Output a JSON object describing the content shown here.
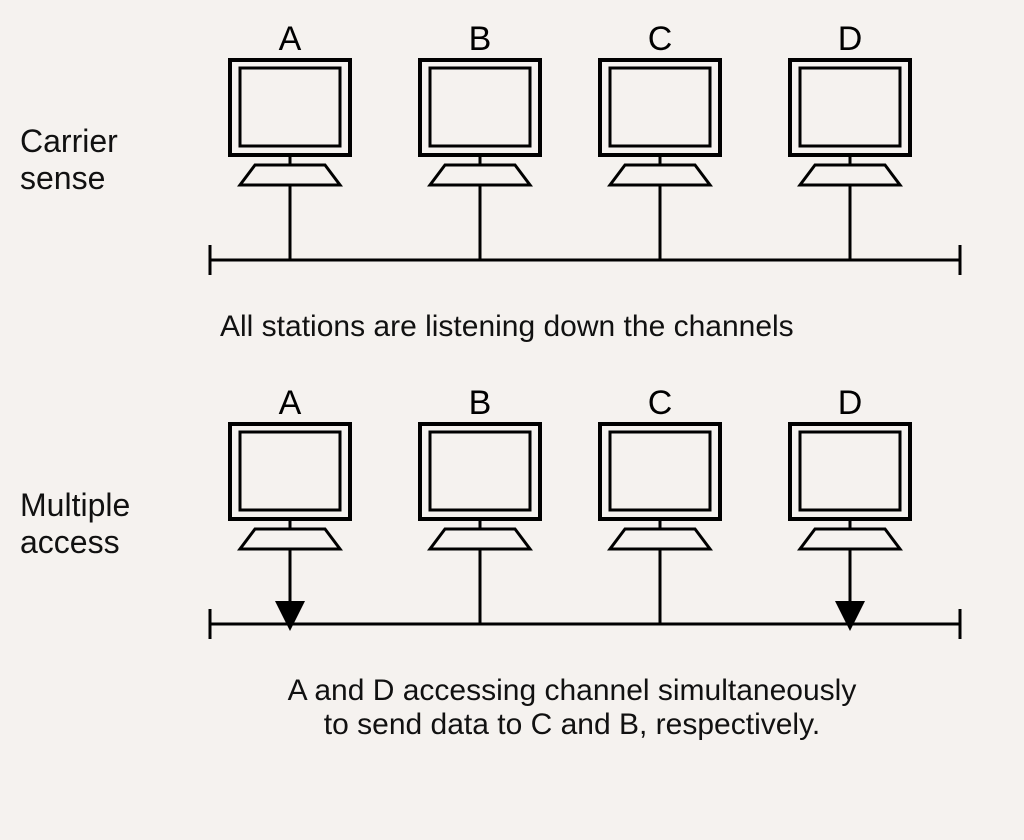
{
  "sections": {
    "top": {
      "label_line1": "Carrier",
      "label_line2": "sense",
      "stations": {
        "a": "A",
        "b": "B",
        "c": "C",
        "d": "D"
      },
      "caption": "All stations are listening down the channels",
      "arrows": false
    },
    "bottom": {
      "label_line1": "Multiple",
      "label_line2": "access",
      "stations": {
        "a": "A",
        "b": "B",
        "c": "C",
        "d": "D"
      },
      "caption_line1": "A and D accessing channel simultaneously",
      "caption_line2": "to send  data to C and B, respectively.",
      "arrows": true
    }
  }
}
